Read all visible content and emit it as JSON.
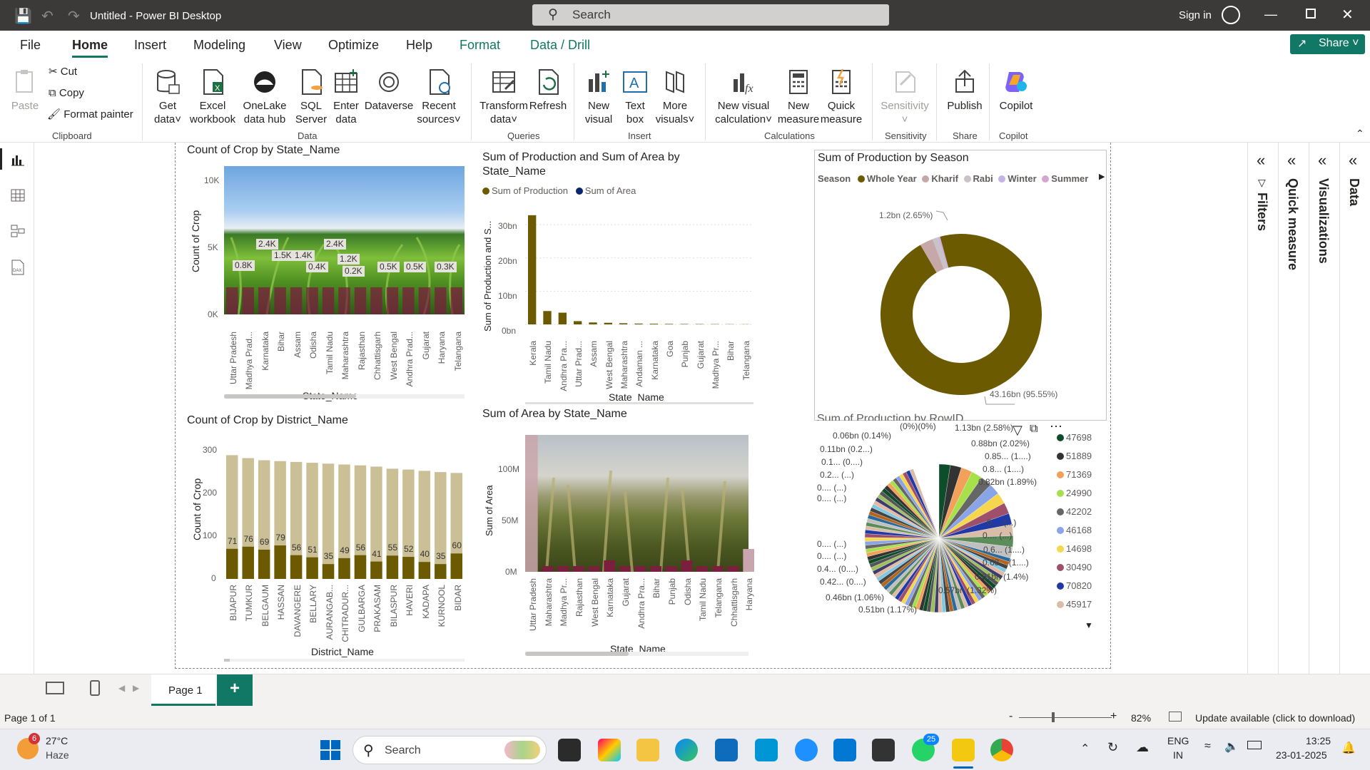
{
  "app": {
    "title": "Untitled - Power BI Desktop",
    "search_placeholder": "Search",
    "sign_in": "Sign in",
    "share": "Share"
  },
  "menu": [
    "File",
    "Home",
    "Insert",
    "Modeling",
    "View",
    "Optimize",
    "Help",
    "Format",
    "Data / Drill"
  ],
  "ribbon": {
    "clipboard": {
      "paste": "Paste",
      "cut": "Cut",
      "copy": "Copy",
      "format_painter": "Format painter",
      "group": "Clipboard"
    },
    "data": {
      "get_data": "Get data",
      "excel": "Excel workbook",
      "onelake": "OneLake data hub",
      "sql": "SQL Server",
      "enter": "Enter data",
      "dataverse": "Dataverse",
      "recent": "Recent sources",
      "group": "Data"
    },
    "queries": {
      "transform": "Transform data",
      "refresh": "Refresh",
      "group": "Queries"
    },
    "insert": {
      "new_visual": "New visual",
      "text_box": "Text box",
      "more_visuals": "More visuals",
      "group": "Insert"
    },
    "calculations": {
      "new_calc": "New visual calculation",
      "new_measure": "New measure",
      "quick_measure": "Quick measure",
      "group": "Calculations"
    },
    "sensitivity": {
      "label": "Sensitivity",
      "group": "Sensitivity"
    },
    "share": {
      "publish": "Publish",
      "group": "Share"
    },
    "copilot": {
      "label": "Copilot",
      "group": "Copilot"
    }
  },
  "panes": {
    "filters": "Filters",
    "quick_measure": "Quick measure",
    "visualizations": "Visualizations",
    "data": "Data"
  },
  "pages": {
    "tab": "Page 1",
    "add": "+"
  },
  "status": {
    "page": "Page 1 of 1",
    "zoom": "82%",
    "update": "Update available (click to download)",
    "zoom_minus": "-",
    "zoom_plus": "+"
  },
  "taskbar": {
    "weather_temp": "27°C",
    "weather_desc": "Haze",
    "weather_badge": "6",
    "search": "Search",
    "lang1": "ENG",
    "lang2": "IN",
    "time": "13:25",
    "date": "23-01-2025",
    "whatsapp_badge": "25"
  },
  "chart_data": [
    {
      "type": "bar",
      "title": "Count of Crop by State_Name",
      "xlabel": "State_Name",
      "ylabel": "Count of Crop",
      "ylim": [
        0,
        10000
      ],
      "yticks": [
        "0K",
        "5K",
        "10K"
      ],
      "categories": [
        "Uttar Pradesh",
        "Madhya Prad...",
        "Karnataka",
        "Bihar",
        "Assam",
        "Odisha",
        "Tamil Nadu",
        "Maharashtra",
        "Rajasthan",
        "Chhattisgarh",
        "West Bengal",
        "Andhra Prad...",
        "Gujarat",
        "Haryana",
        "Telangana"
      ],
      "labels": [
        "0.8K",
        "2.4K",
        "1.5K",
        "",
        "1.4K",
        "0.4K",
        "2.4K",
        "1.2K",
        "0.2K",
        "",
        "0.5K",
        "",
        "0.5K",
        "",
        "0.3K"
      ]
    },
    {
      "type": "bar",
      "title": "Sum of Production and Sum of Area by State_Name",
      "xlabel": "State_Name",
      "ylabel": "Sum of Production and S...",
      "yticks": [
        "0bn",
        "10bn",
        "20bn",
        "30bn"
      ],
      "ylim": [
        0,
        35
      ],
      "series": [
        {
          "name": "Sum of Production",
          "color": "#6b5a00"
        },
        {
          "name": "Sum of Area",
          "color": "#0b2670"
        }
      ],
      "categories": [
        "Kerala",
        "Tamil Nadu",
        "Andhra Pra...",
        "Uttar Prad...",
        "Assam",
        "West Bengal",
        "Maharashtra",
        "Andaman ...",
        "Karnataka",
        "Goa",
        "Punjab",
        "Gujarat",
        "Madhya Pr...",
        "Bihar",
        "Telangana"
      ],
      "values": [
        33.5,
        4.1,
        3.6,
        1.0,
        0.6,
        0.5,
        0.35,
        0.25,
        0.2,
        0.15,
        0.12,
        0.1,
        0.08,
        0.06,
        0.05
      ]
    },
    {
      "type": "pie",
      "title": "Sum of Production by Season",
      "legend_title": "Season",
      "series": [
        {
          "name": "Whole Year",
          "value": 43.16,
          "label": "43.16bn (95.55%)",
          "color": "#6b5a00"
        },
        {
          "name": "Kharif",
          "value": 1.2,
          "label": "1.2bn (2.65%)",
          "color": "#c7a8a8"
        },
        {
          "name": "Rabi",
          "value": 0.5,
          "color": "#c9c3c9"
        },
        {
          "name": "Winter",
          "value": 0.1,
          "color": "#c3b3e6"
        },
        {
          "name": "Summer",
          "value": 0.1,
          "color": "#d4a6cf"
        }
      ]
    },
    {
      "type": "bar",
      "title": "Count of Crop by District_Name",
      "xlabel": "District_Name",
      "ylabel": "Count of Crop",
      "ylim": [
        0,
        300
      ],
      "yticks": [
        "0",
        "100",
        "200",
        "300"
      ],
      "categories": [
        "BIJAPUR",
        "TUMKUR",
        "BELGAUM",
        "HASSAN",
        "DAVANGERE",
        "BELLARY",
        "AURANGAB...",
        "CHITRADUR...",
        "GULBARGA",
        "PRAKASAM",
        "BILASPUR",
        "HAVERI",
        "KADAPA",
        "KURNOOL",
        "BIDAR"
      ],
      "values": [
        292,
        285,
        280,
        278,
        276,
        274,
        272,
        270,
        268,
        265,
        260,
        258,
        255,
        252,
        250
      ],
      "labels": [
        "71",
        "76",
        "69",
        "79",
        "56",
        "51",
        "35",
        "49",
        "56",
        "41",
        "55",
        "52",
        "40",
        "35",
        "60"
      ]
    },
    {
      "type": "bar",
      "title": "Sum of Area by State_Name",
      "xlabel": "State_Name",
      "ylabel": "Sum of Area",
      "ylim": [
        0,
        130
      ],
      "yticks": [
        "0M",
        "50M",
        "100M"
      ],
      "categories": [
        "Uttar Pradesh",
        "Maharashtra",
        "Madhya Pr...",
        "Rajasthan",
        "West Bengal",
        "Karnataka",
        "Gujarat",
        "Andhra Pra...",
        "Bihar",
        "Punjab",
        "Odisha",
        "Tamil Nadu",
        "Telangana",
        "Chhattisgarh",
        "Haryana"
      ]
    },
    {
      "type": "pie",
      "title": "Sum of Production by RowID",
      "labels_left": [
        "0.06bn (0.14%)",
        "0.11bn (0.2...)",
        "0.1... (0....)",
        "0.2... (...)",
        "0.... (...)",
        "0.... (...)",
        "0.... (...)",
        "0.... (...)",
        "0.4... (0....)",
        "0.42... (0....)",
        "0.46bn (1.06%)",
        "0.51bn (1.17%)"
      ],
      "labels_right": [
        "1.13bn (2.58%)",
        "0.88bn (2.02%)",
        "0.85... (1....)",
        "0.8... (1....)",
        "0.82bn (1.89%)",
        "0.... (...)",
        "0.... (...)",
        "0.6... (1....)",
        "0.63... (1....)",
        "0.61bn (1.4%)",
        "0.57bn (1.32%)"
      ],
      "labels_top": [
        "(0%)(0%)"
      ],
      "legend": [
        {
          "name": "47698",
          "color": "#0e4d2a"
        },
        {
          "name": "51889",
          "color": "#333333"
        },
        {
          "name": "71369",
          "color": "#f2a05a"
        },
        {
          "name": "24990",
          "color": "#a6e04a"
        },
        {
          "name": "42202",
          "color": "#666666"
        },
        {
          "name": "46168",
          "color": "#8aa4e8"
        },
        {
          "name": "14698",
          "color": "#f5d64c"
        },
        {
          "name": "30490",
          "color": "#9e4f6b"
        },
        {
          "name": "70820",
          "color": "#1f3aa6"
        },
        {
          "name": "45917",
          "color": "#d9bda8"
        }
      ]
    }
  ]
}
